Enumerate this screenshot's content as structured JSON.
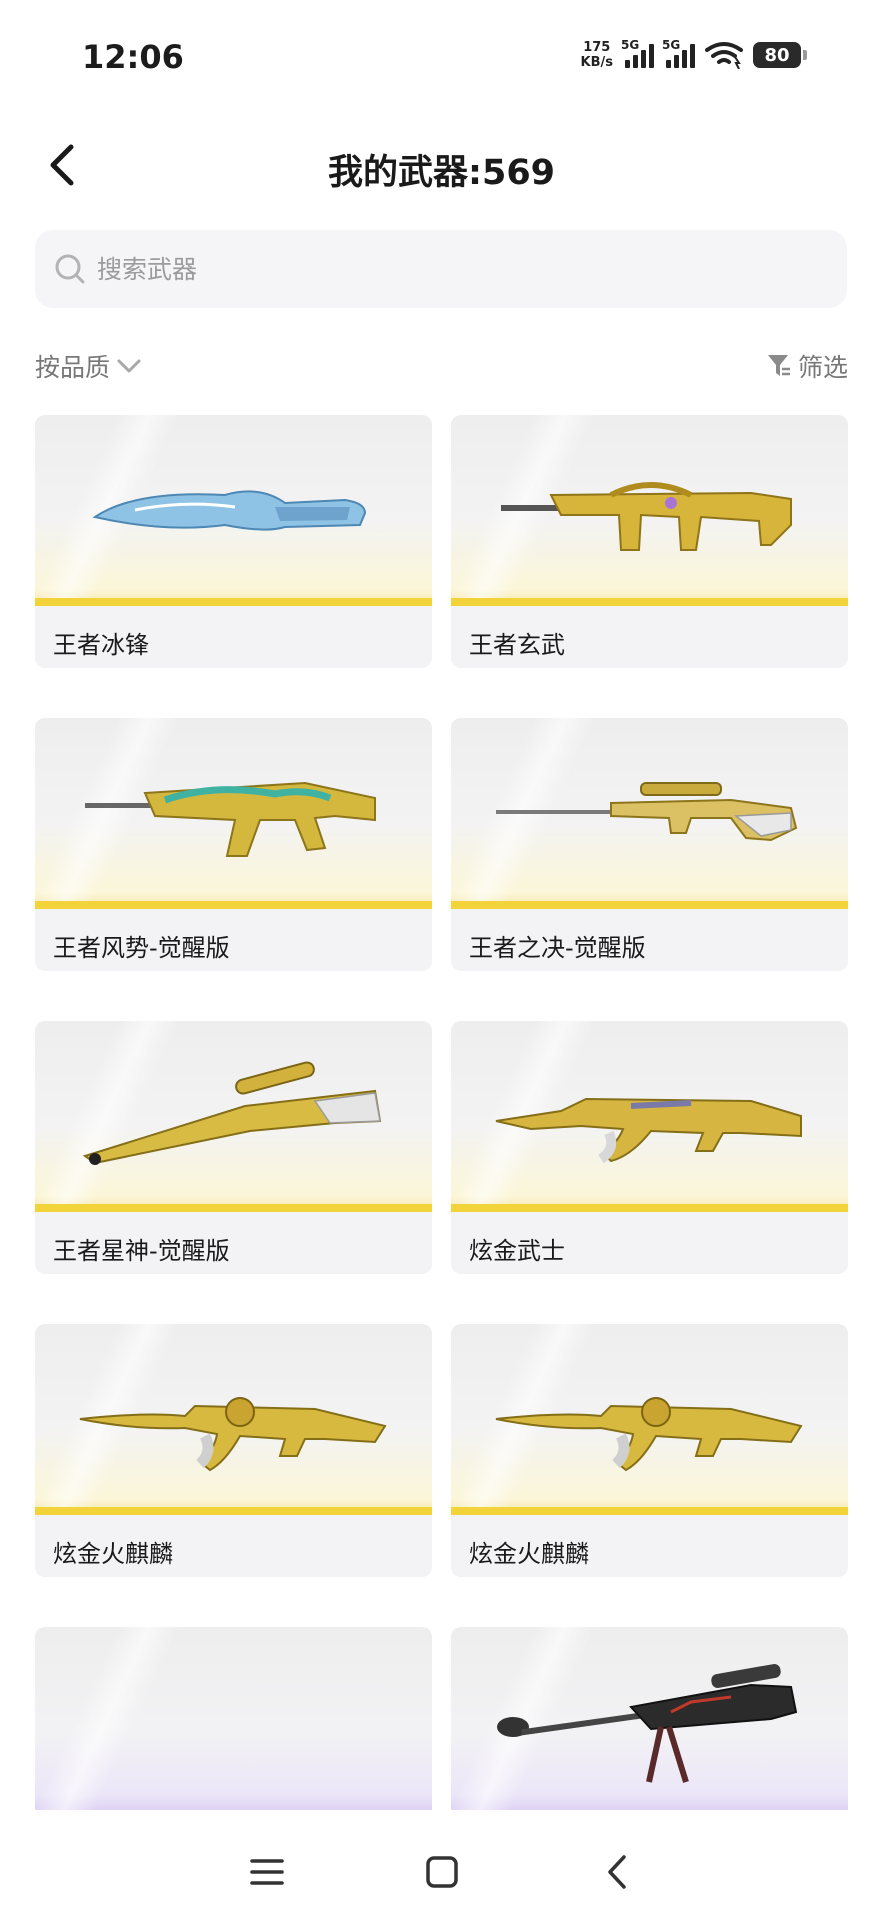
{
  "status": {
    "time": "12:06",
    "net_speed_value": "175",
    "net_speed_unit": "KB/s",
    "signal1_tag": "5G",
    "signal2_tag": "5G",
    "battery": "80"
  },
  "header": {
    "title": "我的武器:569"
  },
  "search": {
    "placeholder": "搜索武器"
  },
  "toolbar": {
    "sort_label": "按品质",
    "filter_label": "筛选"
  },
  "weapons": [
    {
      "name": "王者冰锋",
      "rarity_color": "#f2d43a"
    },
    {
      "name": "王者玄武",
      "rarity_color": "#f2d43a"
    },
    {
      "name": "王者风势-觉醒版",
      "rarity_color": "#f2d43a"
    },
    {
      "name": "王者之决-觉醒版",
      "rarity_color": "#f2d43a"
    },
    {
      "name": "王者星神-觉醒版",
      "rarity_color": "#f2d43a"
    },
    {
      "name": "炫金武士",
      "rarity_color": "#f2d43a"
    },
    {
      "name": "炫金火麒麟",
      "rarity_color": "#f2d43a"
    },
    {
      "name": "炫金火麒麟",
      "rarity_color": "#f2d43a"
    },
    {
      "name": "",
      "rarity_color": "#9b59e6"
    },
    {
      "name": "",
      "rarity_color": "#9b59e6"
    }
  ]
}
